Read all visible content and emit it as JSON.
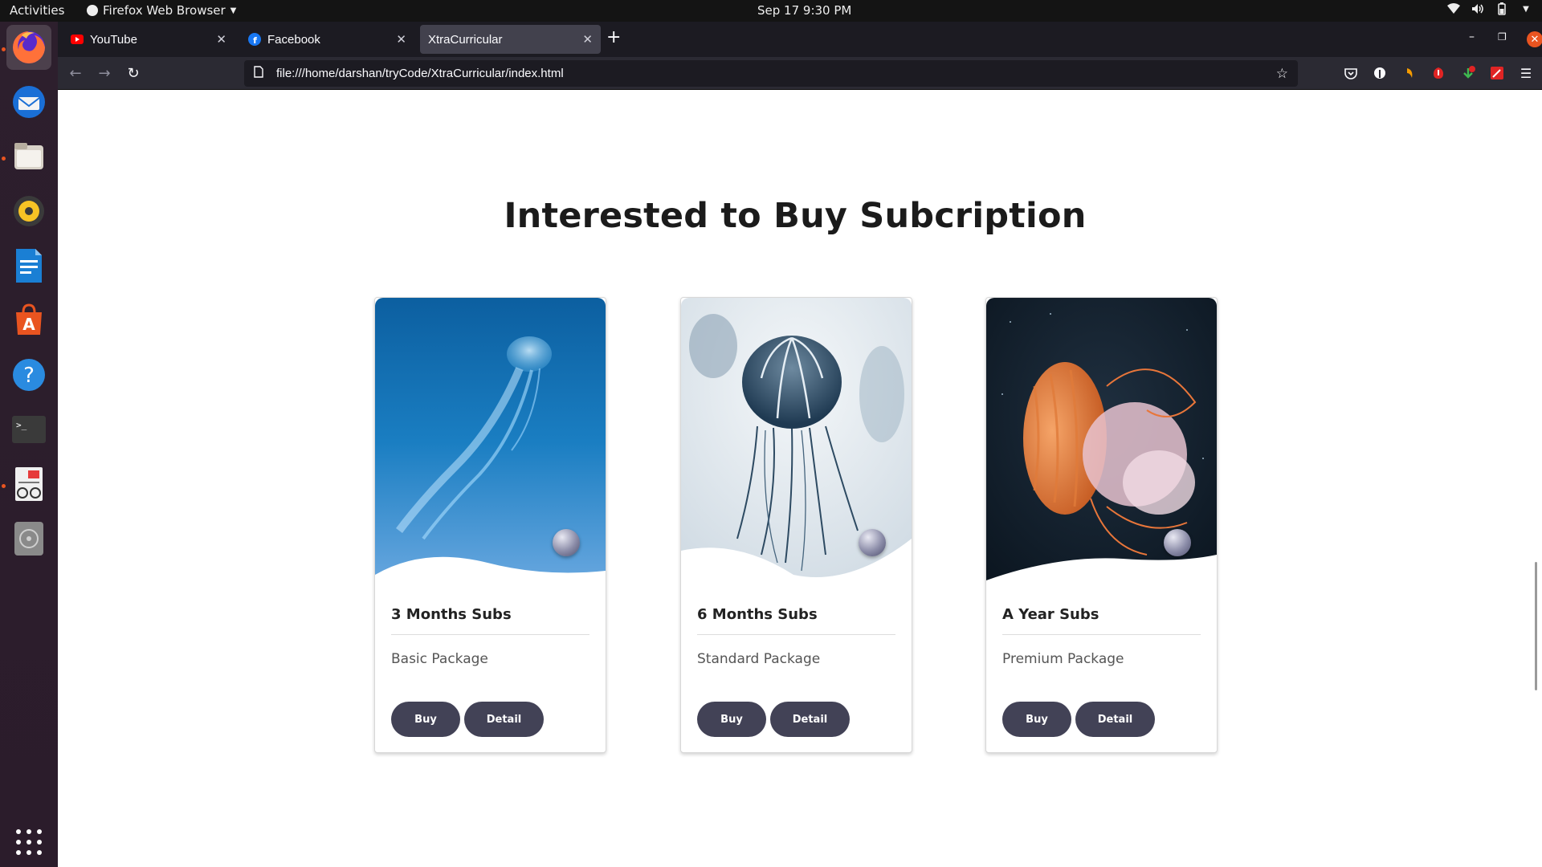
{
  "system_bar": {
    "activities": "Activities",
    "app_menu": "Firefox Web Browser",
    "clock": "Sep 17   9:30 PM"
  },
  "tabs": [
    {
      "title": "YouTube",
      "favicon": "youtube-icon",
      "selected": false
    },
    {
      "title": "Facebook",
      "favicon": "facebook-icon",
      "selected": false
    },
    {
      "title": "XtraCurricular",
      "favicon": "none",
      "selected": true
    }
  ],
  "navbar": {
    "url": "file:///home/darshan/tryCode/XtraCurricular/index.html"
  },
  "page": {
    "heading": "Interested to Buy Subcription",
    "cards": [
      {
        "title": "3 Months Subs",
        "subtitle": "Basic Package",
        "buy_label": "Buy",
        "detail_label": "Detail",
        "theme": "blue-ocean"
      },
      {
        "title": "6 Months Subs",
        "subtitle": "Standard Package",
        "buy_label": "Buy",
        "detail_label": "Detail",
        "theme": "pale-jellyfish"
      },
      {
        "title": "A Year Subs",
        "subtitle": "Premium Package",
        "buy_label": "Buy",
        "detail_label": "Detail",
        "theme": "orange-jellyfish"
      }
    ]
  },
  "dock": [
    "firefox-icon",
    "thunderbird-icon",
    "files-icon",
    "rhythmbox-icon",
    "writer-icon",
    "software-icon",
    "help-icon",
    "terminal-icon",
    "reader-icon",
    "disc-icon",
    "show-apps-icon"
  ],
  "colors": {
    "button": "#424256",
    "accent": "#e95420",
    "tab_selected": "#42414d"
  }
}
